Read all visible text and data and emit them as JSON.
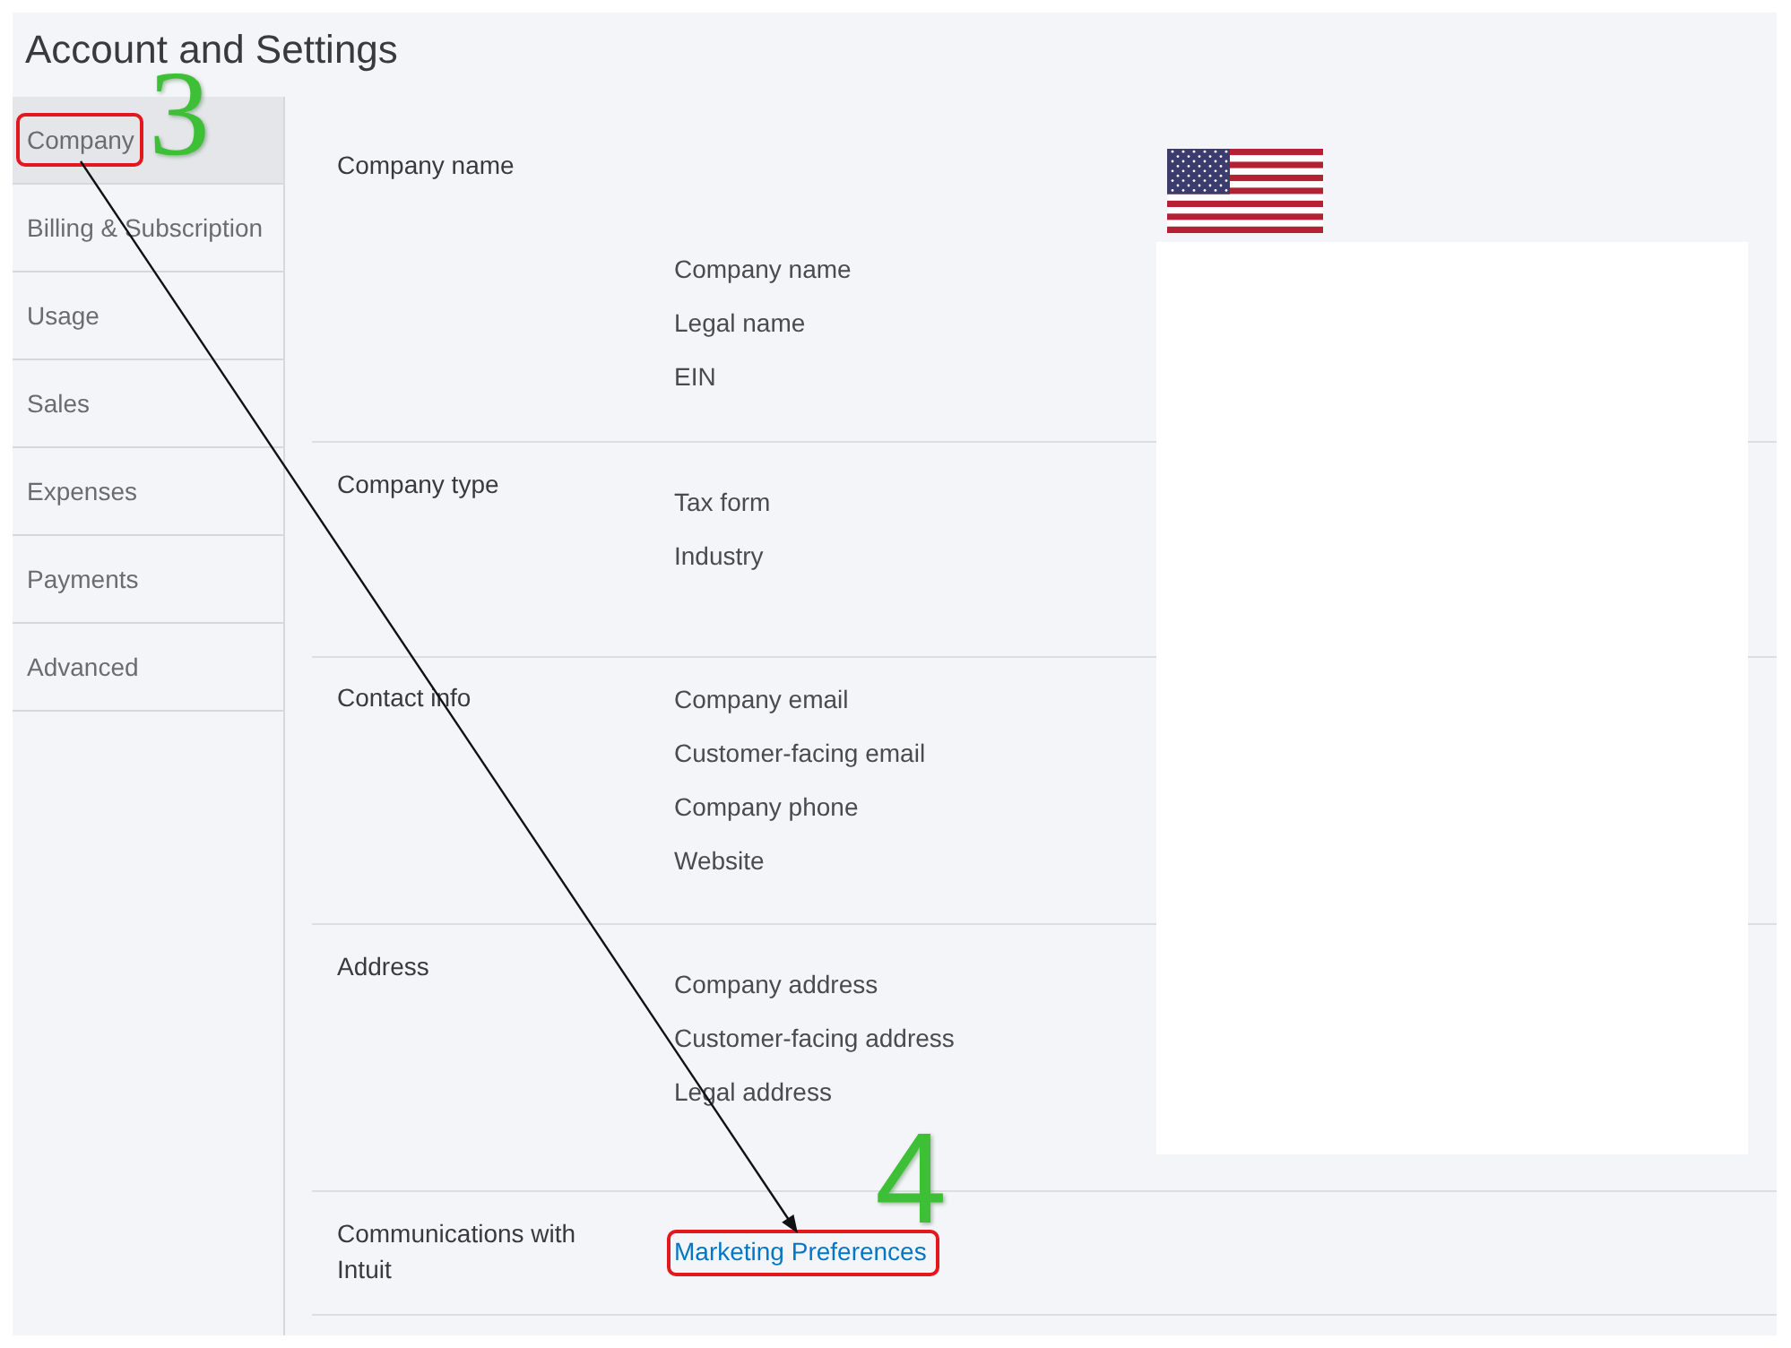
{
  "page": {
    "title": "Account and Settings"
  },
  "sidebar": {
    "items": [
      {
        "label": "Company",
        "selected": true,
        "highlighted": true,
        "callout": "3"
      },
      {
        "label": "Billing & Subscription",
        "selected": false,
        "highlighted": false
      },
      {
        "label": "Usage",
        "selected": false,
        "highlighted": false
      },
      {
        "label": "Sales",
        "selected": false,
        "highlighted": false
      },
      {
        "label": "Expenses",
        "selected": false,
        "highlighted": false
      },
      {
        "label": "Payments",
        "selected": false,
        "highlighted": false
      },
      {
        "label": "Advanced",
        "selected": false,
        "highlighted": false
      }
    ]
  },
  "sections": [
    {
      "kind": "fields",
      "label": "Company name",
      "fields": [
        "Company name",
        "Legal name",
        "EIN"
      ]
    },
    {
      "kind": "fields",
      "label": "Company type",
      "fields": [
        "Tax form",
        "Industry"
      ]
    },
    {
      "kind": "fields",
      "label": "Contact info",
      "fields": [
        "Company email",
        "Customer-facing email",
        "Company phone",
        "Website"
      ]
    },
    {
      "kind": "fields",
      "label": "Address",
      "fields": [
        "Company address",
        "Customer-facing address",
        "Legal address"
      ]
    },
    {
      "kind": "link",
      "label": "Communications with Intuit",
      "link": {
        "text": "Marketing Preferences",
        "highlighted": true,
        "callout": "4"
      }
    }
  ]
}
